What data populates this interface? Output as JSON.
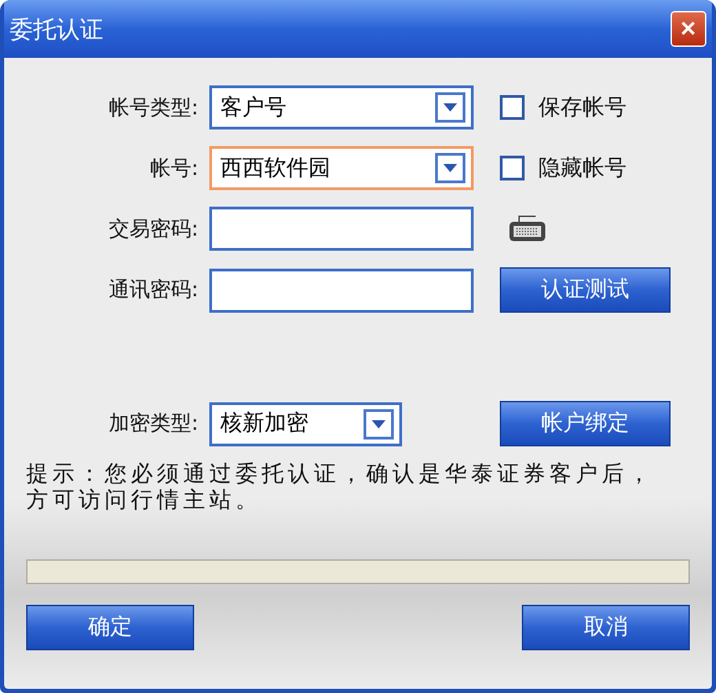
{
  "window": {
    "title": "委托认证",
    "close": "✕"
  },
  "rows": [
    {
      "kind": "select",
      "label": "帐号类型:",
      "value": "客户号",
      "focused": false,
      "side": {
        "kind": "checkbox",
        "label": "保存帐号",
        "checked": false
      }
    },
    {
      "kind": "select",
      "label": "帐号:",
      "value": "西西软件园",
      "focused": true,
      "side": {
        "kind": "checkbox",
        "label": "隐藏帐号",
        "checked": false
      }
    },
    {
      "kind": "input",
      "label": "交易密码:",
      "value": "",
      "focused": false,
      "side": {
        "kind": "keyboard"
      }
    },
    {
      "kind": "input",
      "label": "通讯密码:",
      "value": "",
      "focused": false,
      "side": {
        "kind": "button",
        "label": "认证测试"
      }
    }
  ],
  "encryption": {
    "label": "加密类型:",
    "value": "核新加密",
    "button": "帐户绑定"
  },
  "hint": "提示：您必须通过委托认证，确认是华泰证券客户后，方可访问行情主站。",
  "progress": {
    "level": 0
  },
  "buttons": [
    "确定",
    "取消"
  ]
}
